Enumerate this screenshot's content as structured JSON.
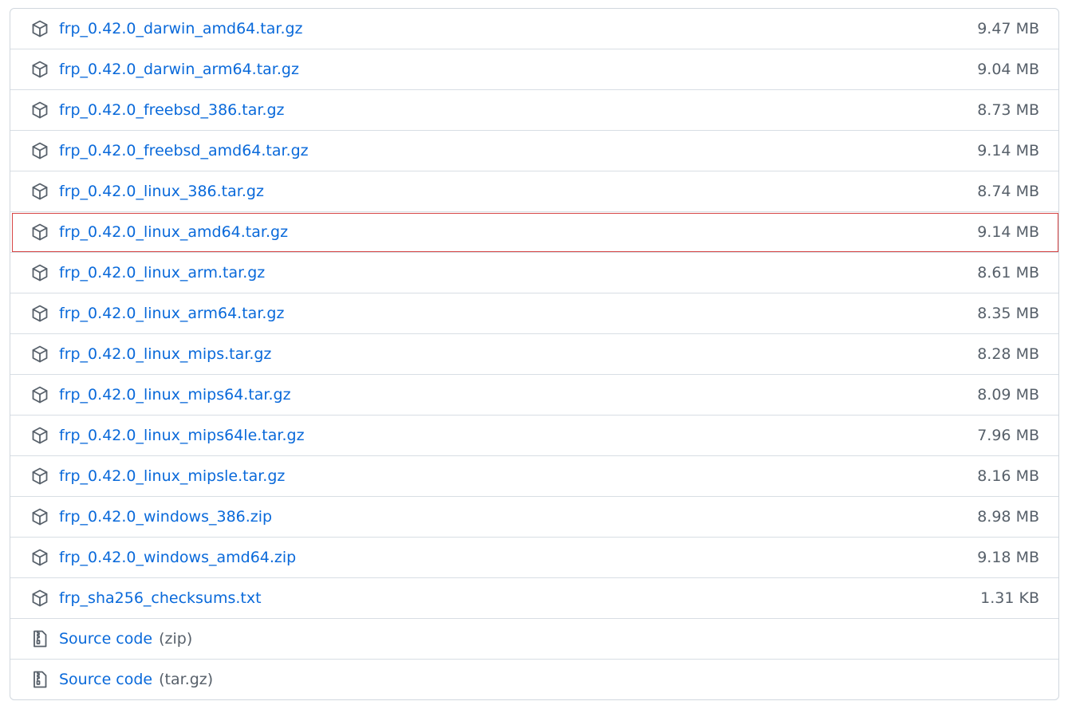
{
  "assets": [
    {
      "name": "frp_0.42.0_darwin_amd64.tar.gz",
      "size": "9.47 MB",
      "icon": "package-icon"
    },
    {
      "name": "frp_0.42.0_darwin_arm64.tar.gz",
      "size": "9.04 MB",
      "icon": "package-icon"
    },
    {
      "name": "frp_0.42.0_freebsd_386.tar.gz",
      "size": "8.73 MB",
      "icon": "package-icon"
    },
    {
      "name": "frp_0.42.0_freebsd_amd64.tar.gz",
      "size": "9.14 MB",
      "icon": "package-icon"
    },
    {
      "name": "frp_0.42.0_linux_386.tar.gz",
      "size": "8.74 MB",
      "icon": "package-icon"
    },
    {
      "name": "frp_0.42.0_linux_amd64.tar.gz",
      "size": "9.14 MB",
      "icon": "package-icon",
      "highlighted": true
    },
    {
      "name": "frp_0.42.0_linux_arm.tar.gz",
      "size": "8.61 MB",
      "icon": "package-icon"
    },
    {
      "name": "frp_0.42.0_linux_arm64.tar.gz",
      "size": "8.35 MB",
      "icon": "package-icon"
    },
    {
      "name": "frp_0.42.0_linux_mips.tar.gz",
      "size": "8.28 MB",
      "icon": "package-icon"
    },
    {
      "name": "frp_0.42.0_linux_mips64.tar.gz",
      "size": "8.09 MB",
      "icon": "package-icon"
    },
    {
      "name": "frp_0.42.0_linux_mips64le.tar.gz",
      "size": "7.96 MB",
      "icon": "package-icon"
    },
    {
      "name": "frp_0.42.0_linux_mipsle.tar.gz",
      "size": "8.16 MB",
      "icon": "package-icon"
    },
    {
      "name": "frp_0.42.0_windows_386.zip",
      "size": "8.98 MB",
      "icon": "package-icon"
    },
    {
      "name": "frp_0.42.0_windows_amd64.zip",
      "size": "9.18 MB",
      "icon": "package-icon"
    },
    {
      "name": "frp_sha256_checksums.txt",
      "size": "1.31 KB",
      "icon": "package-icon"
    },
    {
      "name": "Source code",
      "suffix": "(zip)",
      "size": "",
      "icon": "file-zip-icon"
    },
    {
      "name": "Source code",
      "suffix": "(tar.gz)",
      "size": "",
      "icon": "file-zip-icon"
    }
  ],
  "colors": {
    "link": "#0969da",
    "muted": "#57606a",
    "border": "#d0d7de",
    "highlight": "#d64545"
  }
}
